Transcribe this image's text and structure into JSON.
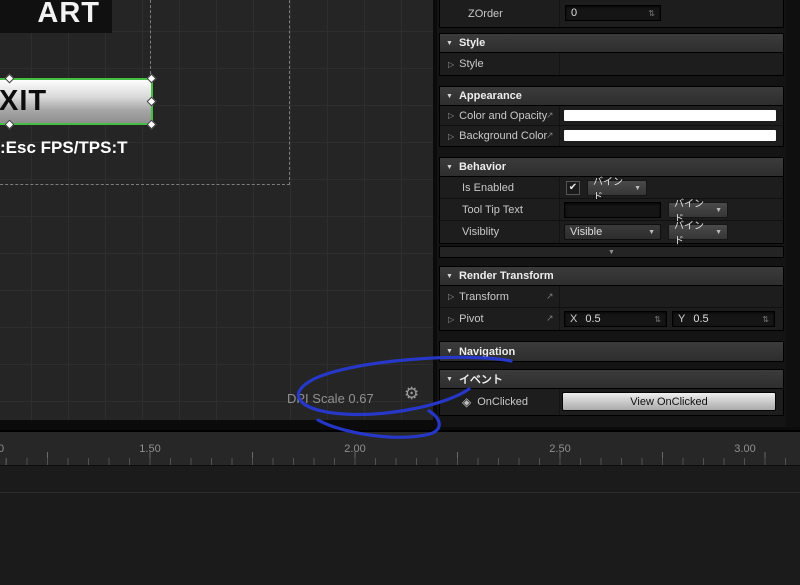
{
  "canvas": {
    "start_button_label": "ART",
    "exit_button_label": "XIT",
    "hint_text": ":Esc FPS/TPS:T",
    "dpi_scale_text": "DPI Scale 0.67"
  },
  "panel": {
    "zorder": {
      "label": "ZOrder",
      "value": "0"
    },
    "style": {
      "header": "Style",
      "row_label": "Style"
    },
    "appearance": {
      "header": "Appearance",
      "color_and_opacity_label": "Color and Opacity",
      "background_color_label": "Background Color",
      "swatch_color": "#ffffff"
    },
    "behavior": {
      "header": "Behavior",
      "is_enabled_label": "Is Enabled",
      "tooltip_label": "Tool Tip Text",
      "tooltip_value": "",
      "visibility_label": "Visiblity",
      "visibility_value": "Visible",
      "bind_button_label": "バインド"
    },
    "render_transform": {
      "header": "Render Transform",
      "transform_label": "Transform",
      "pivot_label": "Pivot",
      "pivot_x_axis": "X",
      "pivot_x_value": "0.5",
      "pivot_y_axis": "Y",
      "pivot_y_value": "0.5"
    },
    "navigation": {
      "header": "Navigation"
    },
    "events": {
      "header": "イベント",
      "onclicked_label": "OnClicked",
      "view_onclicked_button": "View OnClicked"
    }
  },
  "timeline": {
    "tick_labels": [
      "0",
      "1.50",
      "2.00",
      "2.50",
      "3.00"
    ]
  },
  "icons": {
    "expanded": "▼",
    "collapsed": "▷",
    "dropdown": "▼",
    "check": "✔",
    "gear": "⚙",
    "event": "◈",
    "bind_arrow": "↗",
    "spinner": "⇅"
  },
  "colors": {
    "selection_green": "#43c043",
    "annotation_blue": "#2739d2",
    "swatch_white": "#ffffff"
  }
}
